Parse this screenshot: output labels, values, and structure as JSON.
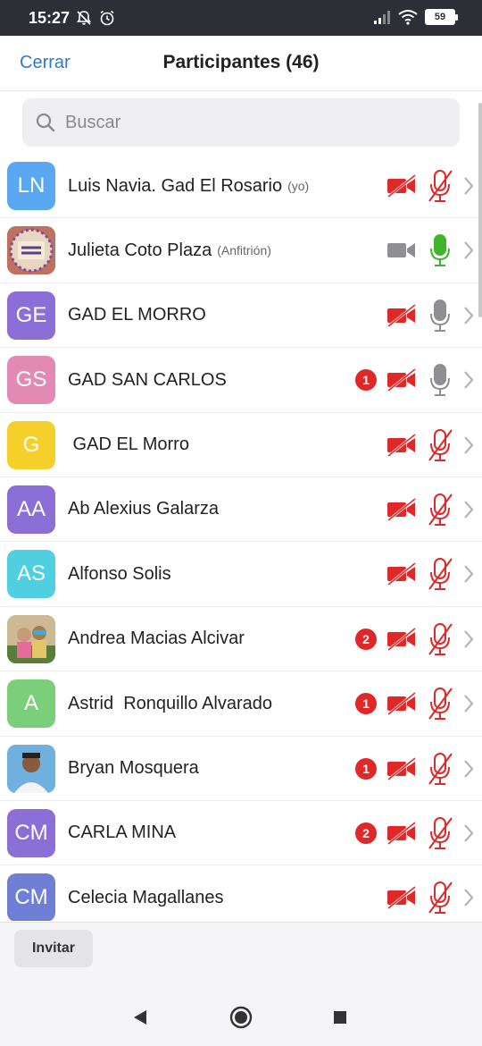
{
  "status_bar": {
    "time": "15:27",
    "battery": "59",
    "icons": [
      "notifications-off-icon",
      "alarm-icon",
      "signal-icon",
      "wifi-icon",
      "battery-icon"
    ]
  },
  "header": {
    "close_label": "Cerrar",
    "title": "Participantes (46)"
  },
  "search": {
    "placeholder": "Buscar",
    "value": ""
  },
  "colors": {
    "accent": "#2d7bd1",
    "muted_red": "#e02828",
    "mic_active": "#3fb52c",
    "icon_gray": "#8e8e93"
  },
  "participants": [
    {
      "initials": "LN",
      "avatar_color": "#5aa9f0",
      "name": "Luis Navia. Gad El Rosario",
      "role": "(yo)",
      "badge": "",
      "video": "off",
      "mic": "muted"
    },
    {
      "initials": "",
      "avatar_color": "#d98f7c",
      "avatar_type": "photo-be-happy",
      "name": "Julieta Coto Plaza",
      "role": "(Anfitrión)",
      "badge": "",
      "video": "on",
      "mic": "active"
    },
    {
      "initials": "GE",
      "avatar_color": "#8b6fd6",
      "name": "GAD EL MORRO",
      "role": "",
      "badge": "",
      "video": "off",
      "mic": "unmuted"
    },
    {
      "initials": "GS",
      "avatar_color": "#e38ab4",
      "name": "GAD SAN CARLOS",
      "role": "",
      "badge": "1",
      "video": "off",
      "mic": "unmuted"
    },
    {
      "initials": "G",
      "avatar_color": "#f5d02a",
      "name": " GAD EL Morro",
      "role": "",
      "badge": "",
      "video": "off",
      "mic": "muted"
    },
    {
      "initials": "AA",
      "avatar_color": "#8b6fd6",
      "name": "Ab Alexius Galarza",
      "role": "",
      "badge": "",
      "video": "off",
      "mic": "muted"
    },
    {
      "initials": "AS",
      "avatar_color": "#4fcfe0",
      "name": "Alfonso Solis",
      "role": "",
      "badge": "",
      "video": "off",
      "mic": "muted"
    },
    {
      "initials": "",
      "avatar_color": "#b9a27a",
      "avatar_type": "photo-people",
      "name": "Andrea Macias Alcivar",
      "role": "",
      "badge": "2",
      "video": "off",
      "mic": "muted"
    },
    {
      "initials": "A",
      "avatar_color": "#7ccf7a",
      "name": "Astrid  Ronquillo Alvarado",
      "role": "",
      "badge": "1",
      "video": "off",
      "mic": "muted"
    },
    {
      "initials": "",
      "avatar_color": "#5aa3d8",
      "avatar_type": "photo-man",
      "name": "Bryan Mosquera",
      "role": "",
      "badge": "1",
      "video": "off",
      "mic": "muted"
    },
    {
      "initials": "CM",
      "avatar_color": "#8b6fd6",
      "name": "CARLA MINA",
      "role": "",
      "badge": "2",
      "video": "off",
      "mic": "muted"
    },
    {
      "initials": "CM",
      "avatar_color": "#6f7fd6",
      "name": "Celecia Magallanes",
      "role": "",
      "badge": "",
      "video": "off",
      "mic": "muted"
    }
  ],
  "footer": {
    "invite_label": "Invitar"
  },
  "nav": {
    "icons": [
      "back-icon",
      "home-icon",
      "recents-icon"
    ]
  }
}
